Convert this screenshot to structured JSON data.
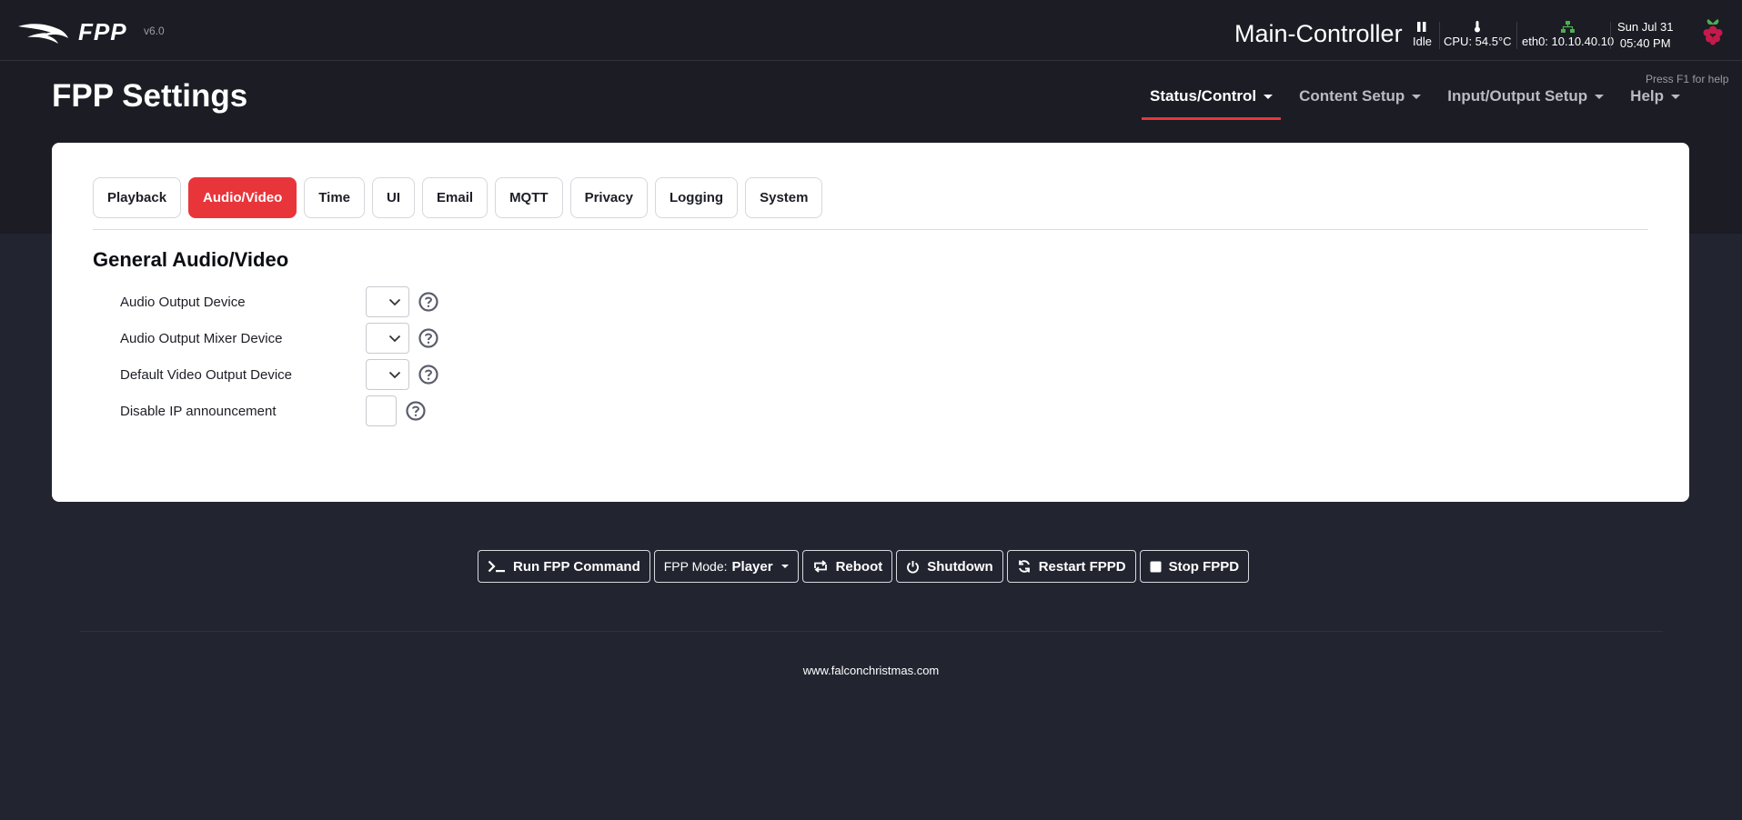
{
  "app": {
    "logo_text": "FPP",
    "version": "v6.0",
    "hostname": "Main-Controller",
    "page_title": "FPP Settings",
    "help_hint": "Press F1 for help"
  },
  "status": {
    "state": "Idle",
    "cpu": "CPU: 54.5°C",
    "network": "eth0: 10.10.40.10",
    "date": "Sun Jul 31",
    "time": "05:40 PM"
  },
  "nav": {
    "items": [
      {
        "label": "Status/Control",
        "active": true
      },
      {
        "label": "Content Setup",
        "active": false
      },
      {
        "label": "Input/Output Setup",
        "active": false
      },
      {
        "label": "Help",
        "active": false
      }
    ]
  },
  "tabs": [
    {
      "label": "Playback",
      "active": false
    },
    {
      "label": "Audio/Video",
      "active": true
    },
    {
      "label": "Time",
      "active": false
    },
    {
      "label": "UI",
      "active": false
    },
    {
      "label": "Email",
      "active": false
    },
    {
      "label": "MQTT",
      "active": false
    },
    {
      "label": "Privacy",
      "active": false
    },
    {
      "label": "Logging",
      "active": false
    },
    {
      "label": "System",
      "active": false
    }
  ],
  "section": {
    "title": "General Audio/Video",
    "settings": [
      {
        "label": "Audio Output Device",
        "control": "select",
        "value": ""
      },
      {
        "label": "Audio Output Mixer Device",
        "control": "select",
        "value": ""
      },
      {
        "label": "Default Video Output Device",
        "control": "select",
        "value": ""
      },
      {
        "label": "Disable IP announcement",
        "control": "checkbox",
        "checked": false
      }
    ]
  },
  "actions": {
    "run_command": "Run FPP Command",
    "mode_label": "FPP Mode:",
    "mode_value": "Player",
    "reboot": "Reboot",
    "shutdown": "Shutdown",
    "restart": "Restart FPPD",
    "stop": "Stop FPPD"
  },
  "footer": {
    "link": "www.falconchristmas.com"
  },
  "colors": {
    "accent": "#e8353a",
    "header_bg": "#1b1c24",
    "page_bg": "#222430",
    "network_icon": "#4caf50"
  },
  "icons": {
    "logo": "falcon-logo-icon",
    "state": "pause-icon",
    "cpu": "thermometer-icon",
    "network": "network-icon",
    "board": "raspberry-pi-icon",
    "help": "question-circle-icon"
  }
}
